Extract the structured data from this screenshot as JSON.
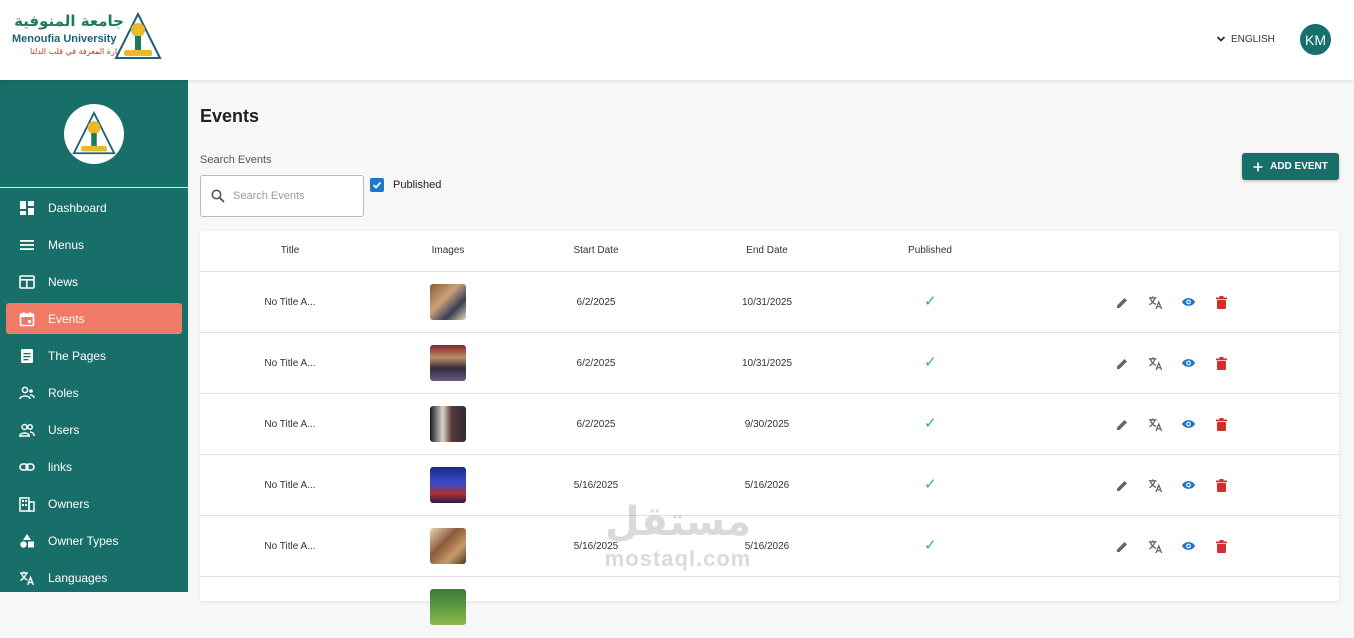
{
  "header": {
    "logo": {
      "arabic_name": "جامعة المنوفية",
      "english_name": "Menoufia University",
      "arabic_tagline": "منارة المعرفة في قلب الدلتا"
    },
    "language_label": "ENGLISH",
    "avatar_initials": "KM"
  },
  "sidebar": {
    "items": [
      {
        "label": "Dashboard",
        "icon": "dashboard-icon",
        "active": false
      },
      {
        "label": "Menus",
        "icon": "menu-icon",
        "active": false
      },
      {
        "label": "News",
        "icon": "news-icon",
        "active": false
      },
      {
        "label": "Events",
        "icon": "calendar-icon",
        "active": true
      },
      {
        "label": "The Pages",
        "icon": "pages-icon",
        "active": false
      },
      {
        "label": "Roles",
        "icon": "roles-icon",
        "active": false
      },
      {
        "label": "Users",
        "icon": "users-icon",
        "active": false
      },
      {
        "label": "links",
        "icon": "link-icon",
        "active": false
      },
      {
        "label": "Owners",
        "icon": "building-icon",
        "active": false
      },
      {
        "label": "Owner Types",
        "icon": "category-icon",
        "active": false
      },
      {
        "label": "Languages",
        "icon": "translate-icon",
        "active": false
      }
    ]
  },
  "main": {
    "title": "Events",
    "search": {
      "label": "Search Events",
      "placeholder": "Search Events",
      "value": ""
    },
    "published_filter": {
      "label": "Published",
      "checked": true
    },
    "add_button_label": "ADD EVENT"
  },
  "table": {
    "columns": [
      "Title",
      "Images",
      "Start Date",
      "End Date",
      "Published"
    ],
    "rows": [
      {
        "title": "No Title A...",
        "start_date": "6/2/2025",
        "end_date": "10/31/2025",
        "published": true
      },
      {
        "title": "No Title A...",
        "start_date": "6/2/2025",
        "end_date": "10/31/2025",
        "published": true
      },
      {
        "title": "No Title A...",
        "start_date": "6/2/2025",
        "end_date": "9/30/2025",
        "published": true
      },
      {
        "title": "No Title A...",
        "start_date": "5/16/2025",
        "end_date": "5/16/2026",
        "published": true
      },
      {
        "title": "No Title A...",
        "start_date": "5/16/2025",
        "end_date": "5/16/2026",
        "published": true
      }
    ]
  },
  "watermark": {
    "arabic": "مستقل",
    "english": "mostaql.com"
  },
  "colors": {
    "sidebar": "#186e68",
    "active_item": "#f07a66",
    "checkbox": "#1f77c9",
    "published_check": "#2bb673",
    "view_icon": "#1f77c9",
    "delete_icon": "#d32f2f"
  }
}
